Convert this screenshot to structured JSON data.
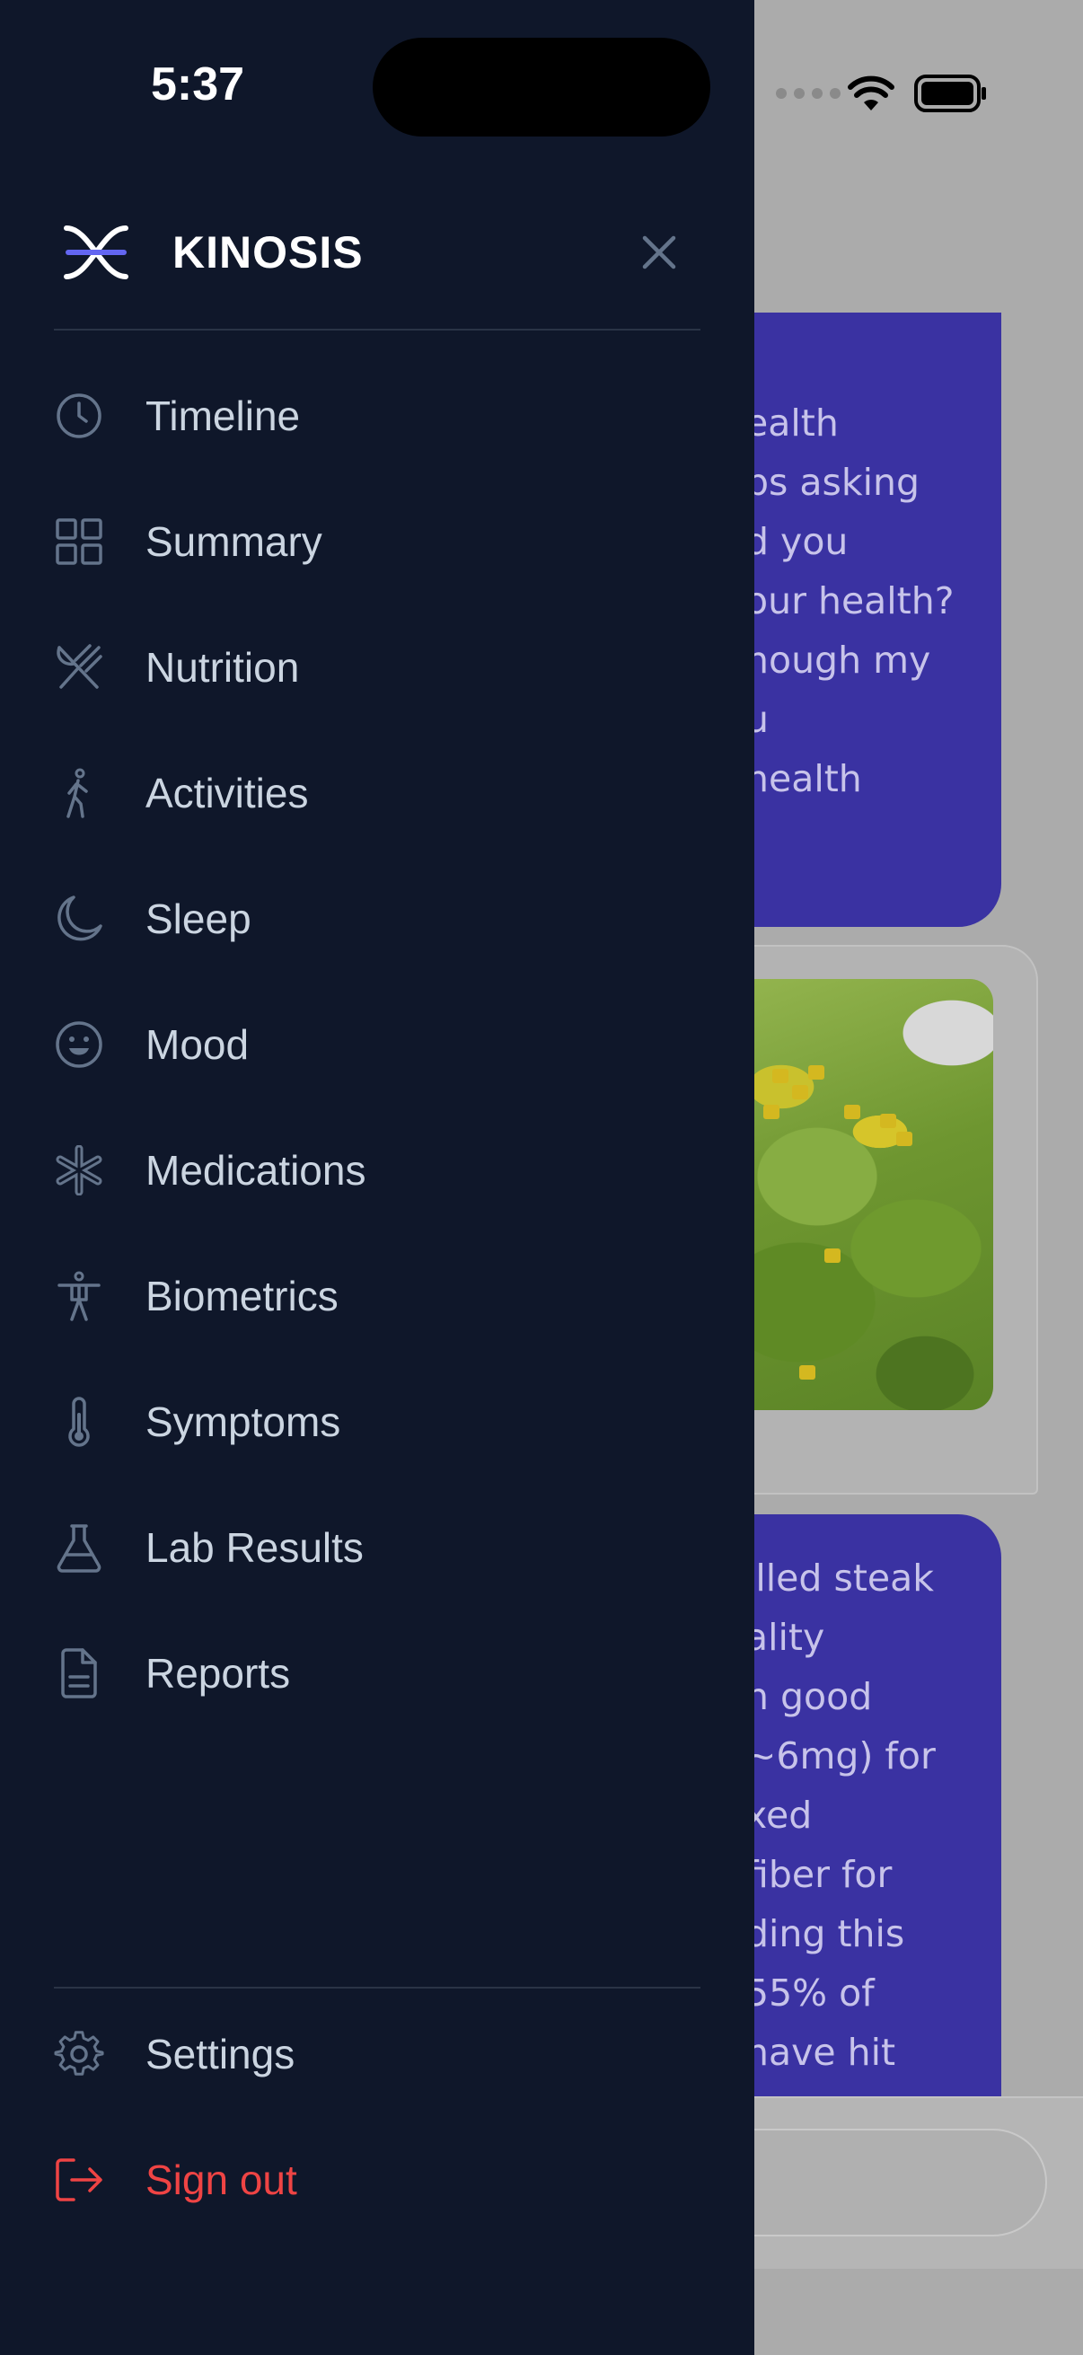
{
  "status_bar": {
    "time": "5:37"
  },
  "brand": {
    "name": "KINOSIS"
  },
  "nav": {
    "items": [
      {
        "label": "Timeline",
        "icon": "clock-icon"
      },
      {
        "label": "Summary",
        "icon": "grid-icon"
      },
      {
        "label": "Nutrition",
        "icon": "utensils-icon"
      },
      {
        "label": "Activities",
        "icon": "walking-icon"
      },
      {
        "label": "Sleep",
        "icon": "moon-icon"
      },
      {
        "label": "Mood",
        "icon": "smile-icon"
      },
      {
        "label": "Medications",
        "icon": "asterisk-icon"
      },
      {
        "label": "Biometrics",
        "icon": "person-icon"
      },
      {
        "label": "Symptoms",
        "icon": "thermometer-icon"
      },
      {
        "label": "Lab Results",
        "icon": "flask-icon"
      },
      {
        "label": "Reports",
        "icon": "document-icon"
      }
    ]
  },
  "footer": {
    "settings": {
      "label": "Settings",
      "icon": "gear-icon"
    },
    "sign_out": {
      "label": "Sign out",
      "icon": "sign-out-icon"
    }
  },
  "background_chat": {
    "bubble1_lines": [
      "ealth",
      "ps asking",
      "d you",
      "our health?",
      "hough my",
      "u",
      "health"
    ],
    "bubble2_lines": [
      "illed steak",
      "ality",
      "n good",
      "~6mg) for",
      "xed",
      "fiber for",
      "ding this",
      "55% of",
      "have hit"
    ]
  },
  "colors": {
    "drawer_bg": "#0f172a",
    "nav_text": "#cbd5e1",
    "danger": "#ef4444",
    "bubble_bg": "#3a32a2",
    "logo_accent": "#6366f1"
  }
}
